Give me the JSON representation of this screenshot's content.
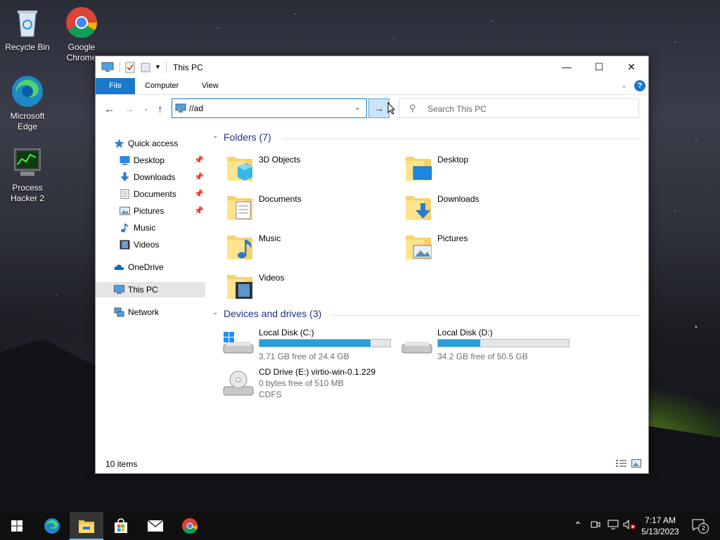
{
  "desktop": {
    "icons": [
      {
        "label": "Recycle Bin"
      },
      {
        "label": "Google Chrome"
      },
      {
        "label": "Microsoft Edge"
      },
      {
        "label": "Process Hacker 2"
      }
    ]
  },
  "window": {
    "title": "This PC",
    "controls": {
      "minimize": "—",
      "maximize": "☐",
      "close": "✕"
    },
    "ribbon_tabs": [
      "File",
      "Computer",
      "View"
    ],
    "address": "//ad",
    "search_placeholder": "Search This PC",
    "go_arrow": "→"
  },
  "sidebar": {
    "items": [
      {
        "label": "Quick access",
        "icon": "star-icon"
      },
      {
        "label": "Desktop",
        "icon": "desktop-icon",
        "pinned": true
      },
      {
        "label": "Downloads",
        "icon": "download-icon",
        "pinned": true
      },
      {
        "label": "Documents",
        "icon": "document-icon",
        "pinned": true
      },
      {
        "label": "Pictures",
        "icon": "picture-icon",
        "pinned": true
      },
      {
        "label": "Music",
        "icon": "music-icon"
      },
      {
        "label": "Videos",
        "icon": "video-icon"
      },
      {
        "label": "OneDrive",
        "icon": "cloud-icon"
      },
      {
        "label": "This PC",
        "icon": "computer-icon",
        "selected": true
      },
      {
        "label": "Network",
        "icon": "network-icon"
      }
    ]
  },
  "content": {
    "folders_header": "Folders (7)",
    "folders": [
      {
        "name": "3D Objects"
      },
      {
        "name": "Desktop"
      },
      {
        "name": "Documents"
      },
      {
        "name": "Downloads"
      },
      {
        "name": "Music"
      },
      {
        "name": "Pictures"
      },
      {
        "name": "Videos"
      }
    ],
    "drives_header": "Devices and drives (3)",
    "drives": [
      {
        "name": "Local Disk (C:)",
        "free": "3.71 GB free of 24.4 GB",
        "used_fraction": 0.85
      },
      {
        "name": "Local Disk (D:)",
        "free": "34.2 GB free of 50.5 GB",
        "used_fraction": 0.32
      },
      {
        "name": "CD Drive (E:) virtio-win-0.1.229",
        "free": "0 bytes free of 510 MB",
        "fs": "CDFS"
      }
    ]
  },
  "status": {
    "items": "10 items"
  },
  "taskbar": {
    "clock_time": "7:17 AM",
    "clock_date": "5/13/2023",
    "notification_count": "2"
  },
  "colors": {
    "accent": "#1979ca",
    "drive_bar": "#26a0da",
    "section_header": "#1e3287"
  }
}
